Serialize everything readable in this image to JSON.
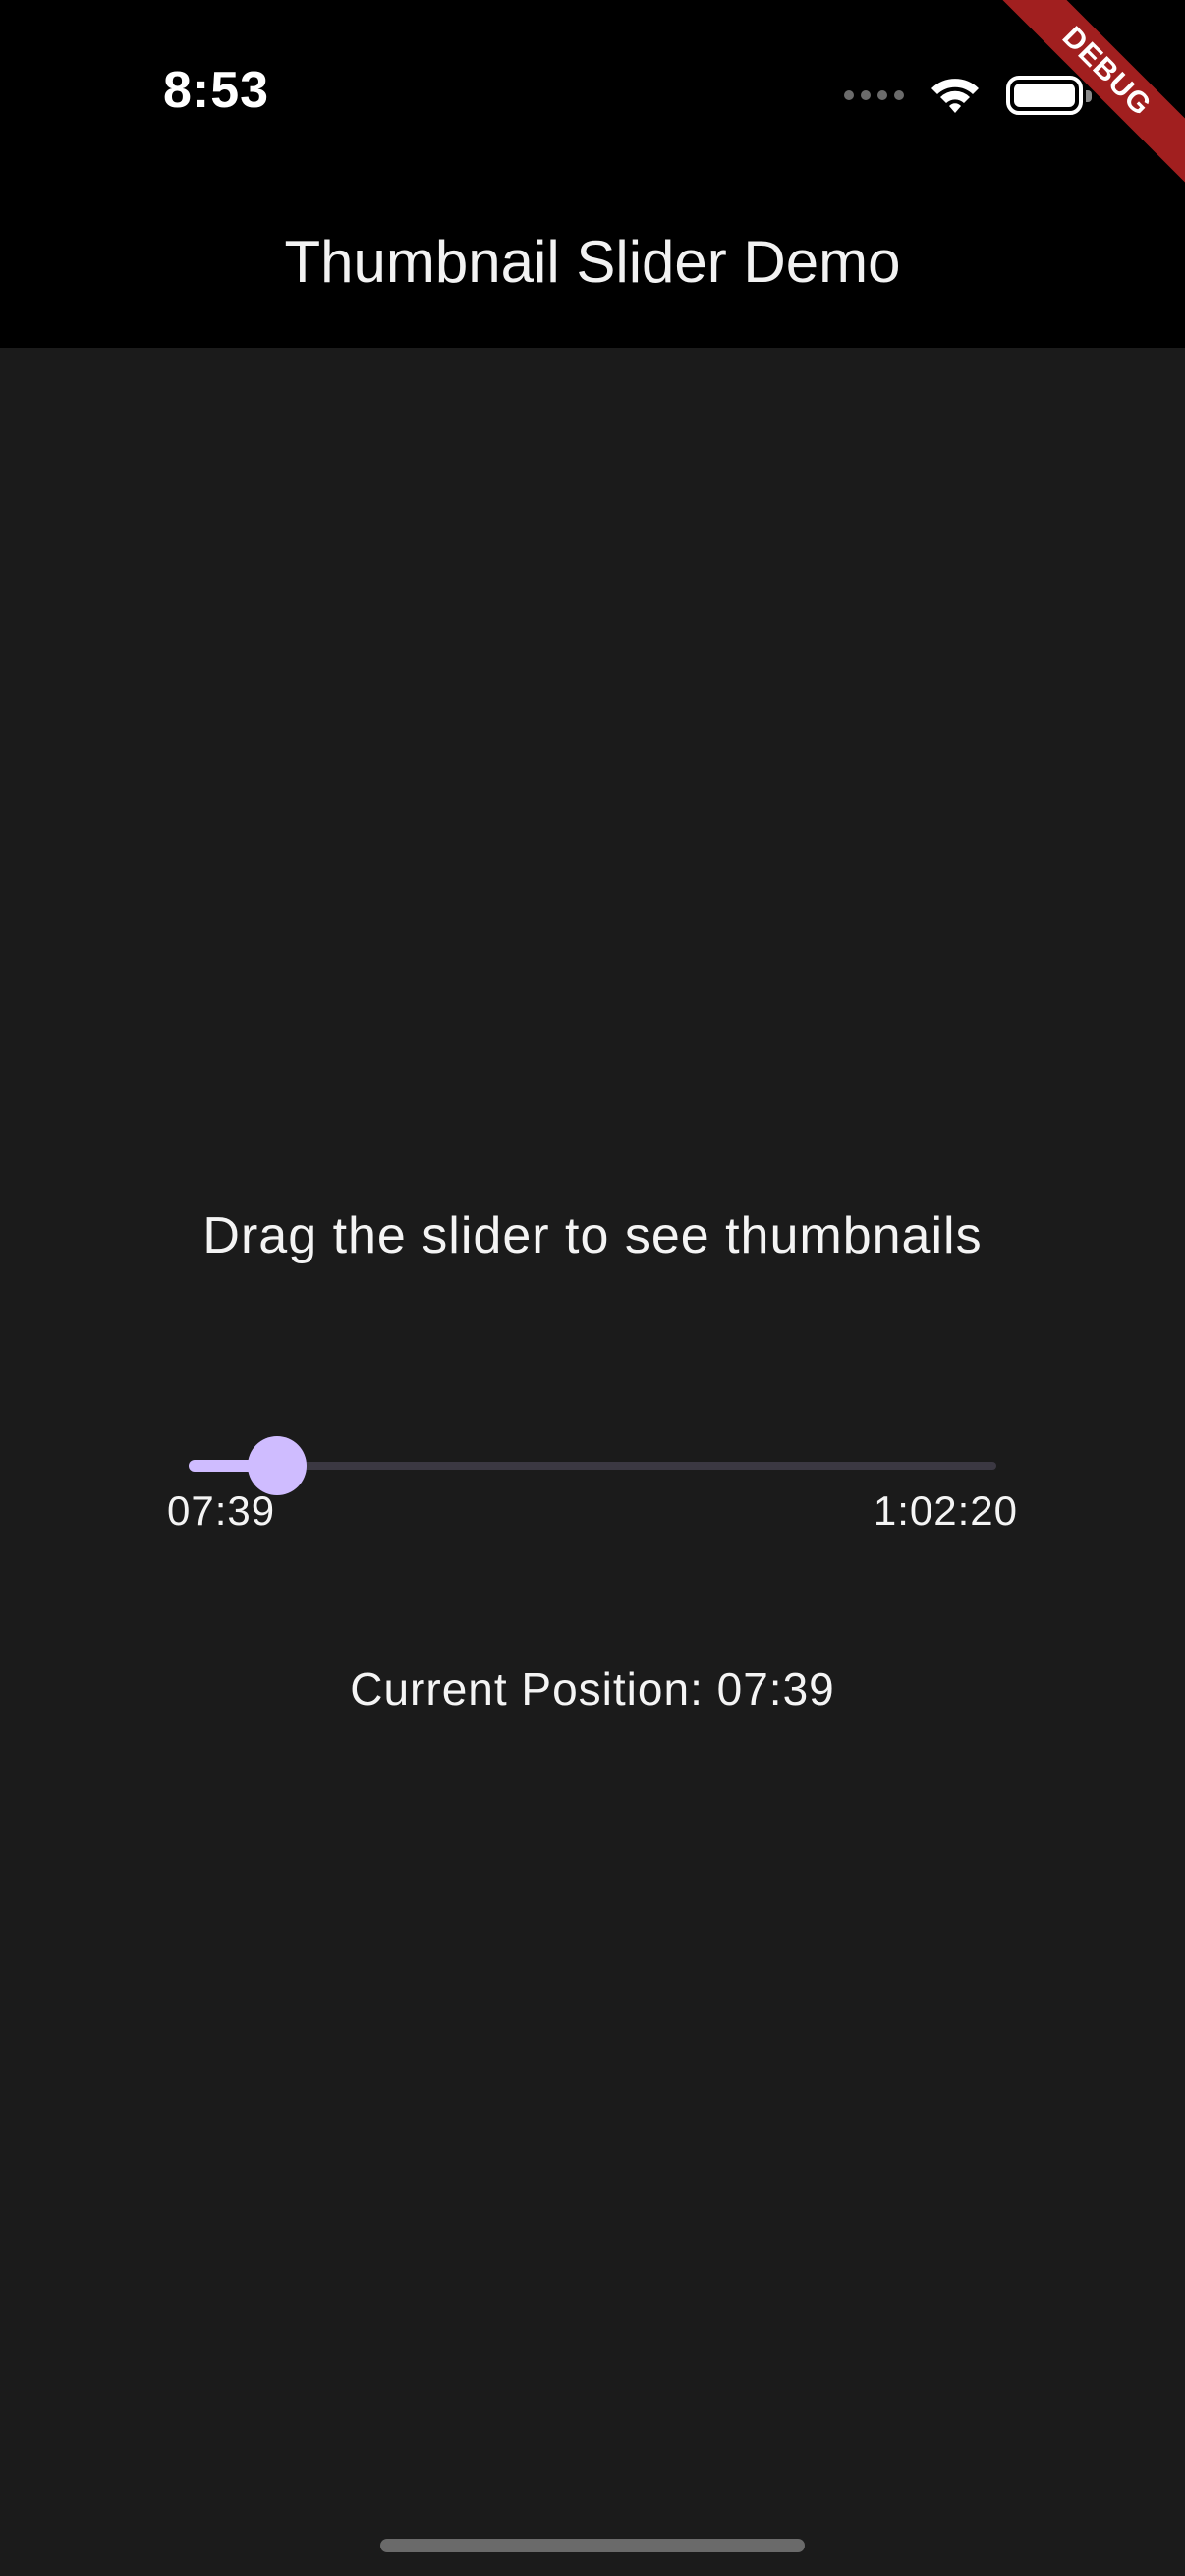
{
  "status_bar": {
    "time": "8:53",
    "icons": [
      "signal-dots-icon",
      "wifi-icon",
      "battery-icon"
    ]
  },
  "debug_banner": "DEBUG",
  "app_bar": {
    "title": "Thumbnail Slider Demo"
  },
  "body": {
    "instruction": "Drag the slider to see thumbnails",
    "slider": {
      "start_label": "07:39",
      "end_label": "1:02:20",
      "value_fraction": 0.109
    },
    "current_position": "Current Position: 07:39"
  },
  "colors": {
    "background": "#1b1b1b",
    "app_bar": "#000000",
    "slider_active": "#cfbcff",
    "slider_inactive": "#3b3842",
    "debug_banner": "#a11f1f"
  }
}
